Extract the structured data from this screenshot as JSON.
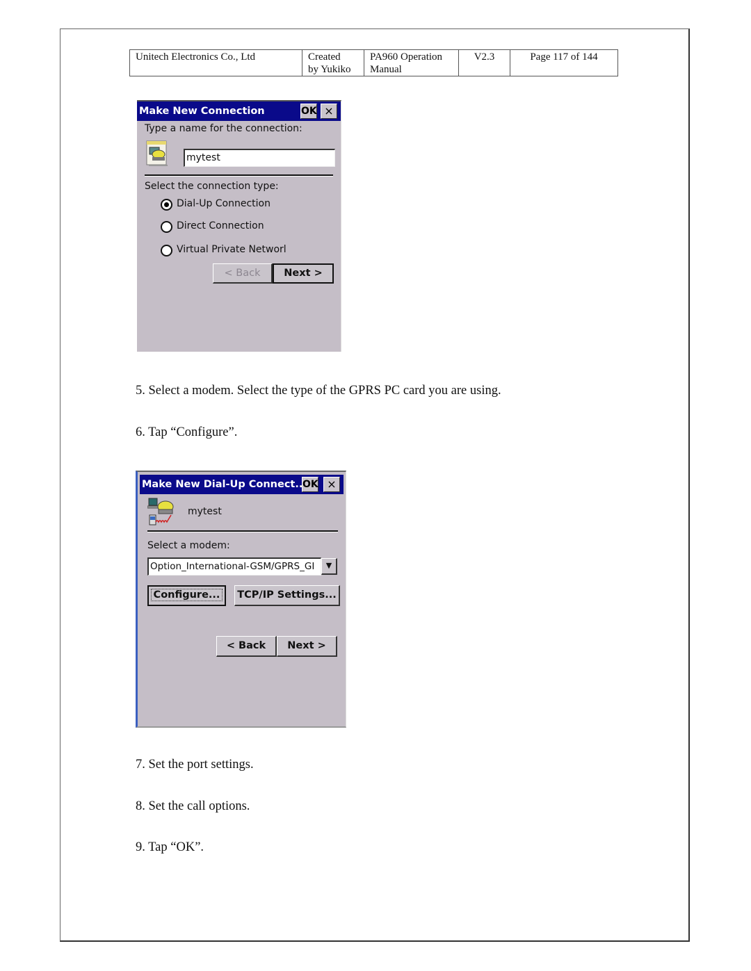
{
  "header": {
    "company": "Unitech Electronics Co., Ltd",
    "created": "Created",
    "created_by": "by Yukiko",
    "doc_line1": "PA960 Operation",
    "doc_line2": "Manual",
    "version": "V2.3",
    "page": "Page 117 of 144"
  },
  "dialog1": {
    "title": "Make New Connection",
    "ok_label": "OK",
    "close_label": "×",
    "name_prompt": "Type a name for the connection:",
    "name_value": "mytest",
    "type_prompt": "Select the connection type:",
    "options": [
      {
        "label": "Dial-Up Connection",
        "checked": true
      },
      {
        "label": "Direct Connection",
        "checked": false
      },
      {
        "label": "Virtual Private Networl",
        "checked": false
      }
    ],
    "back_label": "< Back",
    "next_label": "Next >",
    "icon": "connection-wizard-icon"
  },
  "steps_a": [
    "5. Select a modem. Select the type of the GPRS PC card you are using.",
    "6. Tap “Configure”."
  ],
  "dialog2": {
    "title": "Make New Dial-Up Connect...",
    "ok_label": "OK",
    "close_label": "×",
    "connection_name": "mytest",
    "modem_prompt": "Select a modem:",
    "modem_value": "Option_International-GSM/GPRS_GI",
    "configure_label": "Configure...",
    "tcpip_label": "TCP/IP Settings...",
    "back_label": "< Back",
    "next_label": "Next >",
    "icon": "dialup-connection-icon"
  },
  "steps_b": [
    "7. Set the port settings.",
    "8. Set the call options.",
    "9. Tap “OK”."
  ]
}
